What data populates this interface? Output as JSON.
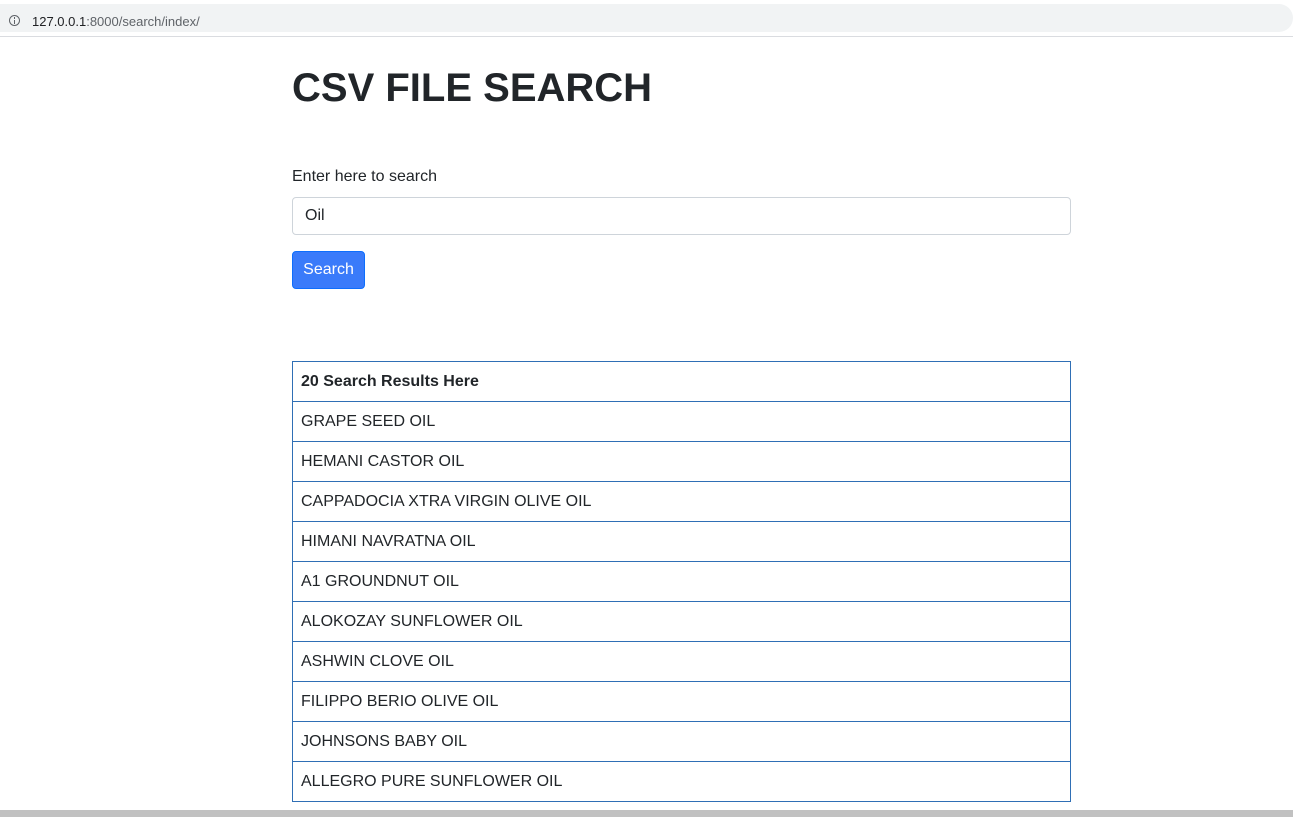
{
  "browser": {
    "url_host": "127.0.0.1",
    "url_path": ":8000/search/index/"
  },
  "page": {
    "title": "CSV FILE SEARCH"
  },
  "search": {
    "label": "Enter here to search",
    "value": "Oil",
    "button_label": "Search"
  },
  "results": {
    "header": "20 Search Results Here",
    "items": [
      "GRAPE SEED OIL",
      "HEMANI CASTOR OIL",
      "CAPPADOCIA XTRA VIRGIN OLIVE OIL",
      "HIMANI NAVRATNA OIL",
      "A1 GROUNDNUT OIL",
      "ALOKOZAY SUNFLOWER OIL",
      "ASHWIN CLOVE OIL",
      "FILIPPO BERIO OLIVE OIL",
      "JOHNSONS BABY OIL",
      "ALLEGRO PURE SUNFLOWER OIL"
    ]
  },
  "colors": {
    "primary_button": "#3a7bfa",
    "table_border": "#2f6fb5",
    "text": "#212529"
  }
}
